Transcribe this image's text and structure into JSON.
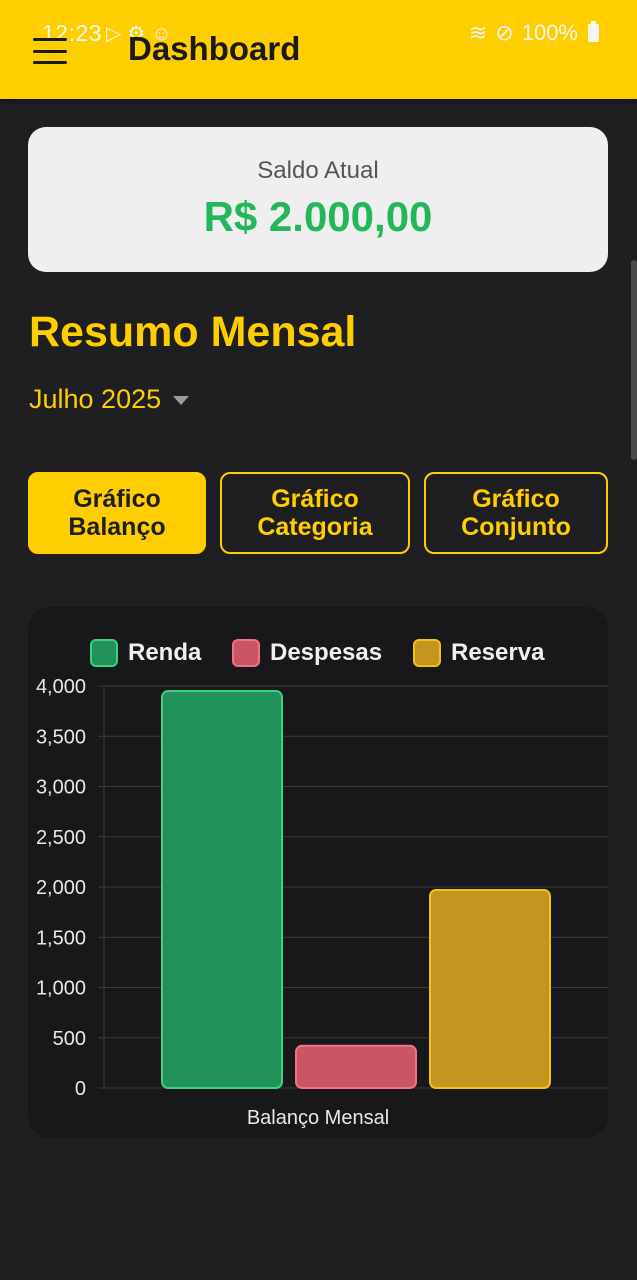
{
  "status_bar": {
    "time": "12:23",
    "battery": "100%"
  },
  "appbar": {
    "title": "Dashboard",
    "menu_icon": "hamburger-menu-icon"
  },
  "balance": {
    "label": "Saldo Atual",
    "value": "R$ 2.000,00"
  },
  "summary": {
    "title": "Resumo Mensal",
    "month": "Julho 2025"
  },
  "tabs": [
    {
      "label": "Gráfico\nBalanço",
      "active": true
    },
    {
      "label": "Gráfico\nCategoria",
      "active": false
    },
    {
      "label": "Gráfico\nConjunto",
      "active": false
    }
  ],
  "colors": {
    "accent": "#ffce00",
    "balance_value": "#22b85a",
    "renda": "#22915a",
    "despesas": "#c95565",
    "reserva": "#c39620"
  },
  "chart_data": {
    "type": "bar",
    "categories": [
      "Balanço Mensal"
    ],
    "series": [
      {
        "name": "Renda",
        "values": [
          3950
        ],
        "color": "#22915a",
        "border": "#3fcf83"
      },
      {
        "name": "Despesas",
        "values": [
          420
        ],
        "color": "#c95565",
        "border": "#f07283"
      },
      {
        "name": "Reserva",
        "values": [
          1970
        ],
        "color": "#c39620",
        "border": "#f2c21c"
      }
    ],
    "yticks": [
      "4,000",
      "3,500",
      "3,000",
      "2,500",
      "2,000",
      "1,500",
      "1,000",
      "500",
      "0"
    ],
    "ylim": [
      0,
      4000
    ],
    "xlabel": "",
    "ylabel": "",
    "grid": true,
    "legend": "top"
  }
}
